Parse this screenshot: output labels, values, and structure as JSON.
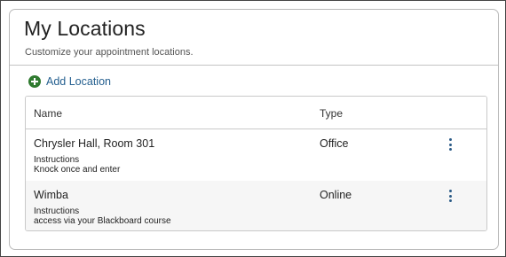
{
  "header": {
    "title": "My Locations",
    "subtitle": "Customize your appointment locations."
  },
  "actions": {
    "add_label": "Add Location",
    "add_icon": "plus-circle-icon",
    "add_icon_color": "#2f7a2f",
    "link_color": "#245f8f"
  },
  "table": {
    "columns": [
      "Name",
      "Type"
    ],
    "rows": [
      {
        "name": "Chrysler Hall, Room 301",
        "instructions_label": "Instructions",
        "instructions": "Knock once and enter",
        "type": "Office",
        "menu_icon": "kebab-menu-icon"
      },
      {
        "name": "Wimba",
        "instructions_label": "Instructions",
        "instructions": "access via your Blackboard course",
        "type": "Online",
        "menu_icon": "kebab-menu-icon"
      }
    ]
  }
}
